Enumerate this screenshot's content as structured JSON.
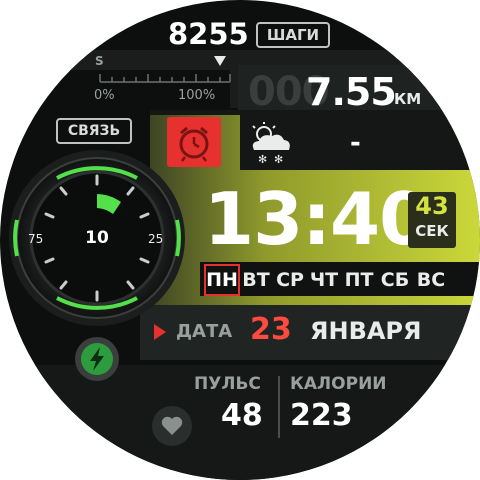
{
  "colors": {
    "accent_yellow": "#c6d43c",
    "accent_green": "#53e04a",
    "red": "#e6312e",
    "panel_dark": "#1c201f",
    "text_light": "#e9ecea"
  },
  "steps": {
    "value": "8255",
    "label": "ШАГИ",
    "progress_start": "0%",
    "progress_end": "100%",
    "scale_letter": "S"
  },
  "distance": {
    "dim_digits": "000",
    "value": "7.55",
    "unit": "КМ"
  },
  "connection": {
    "label": "СВЯЗЬ"
  },
  "alarm": {
    "icon": "alarm-clock-icon"
  },
  "weather": {
    "icon": "snow-cloud-icon",
    "temperature": "-"
  },
  "time": {
    "hours": "13",
    "colon": ":",
    "minutes": "40",
    "seconds": "43",
    "seconds_label": "СЕК"
  },
  "weekdays": {
    "items": [
      "ПН",
      "ВТ",
      "СР",
      "ЧТ",
      "ПТ",
      "СБ",
      "ВС"
    ],
    "active_index": 0
  },
  "date": {
    "label": "ДАТА",
    "day": "23",
    "month": "ЯНВАРЯ"
  },
  "gauge": {
    "value": "10",
    "left_label": "75",
    "right_label": "25",
    "level_fraction": 0.1
  },
  "charge": {
    "icon": "lightning-bolt-icon"
  },
  "heart": {
    "icon": "heart-icon"
  },
  "pulse": {
    "label": "ПУЛЬС",
    "value": "48"
  },
  "calories": {
    "label": "КАЛОРИИ",
    "value": "223"
  }
}
